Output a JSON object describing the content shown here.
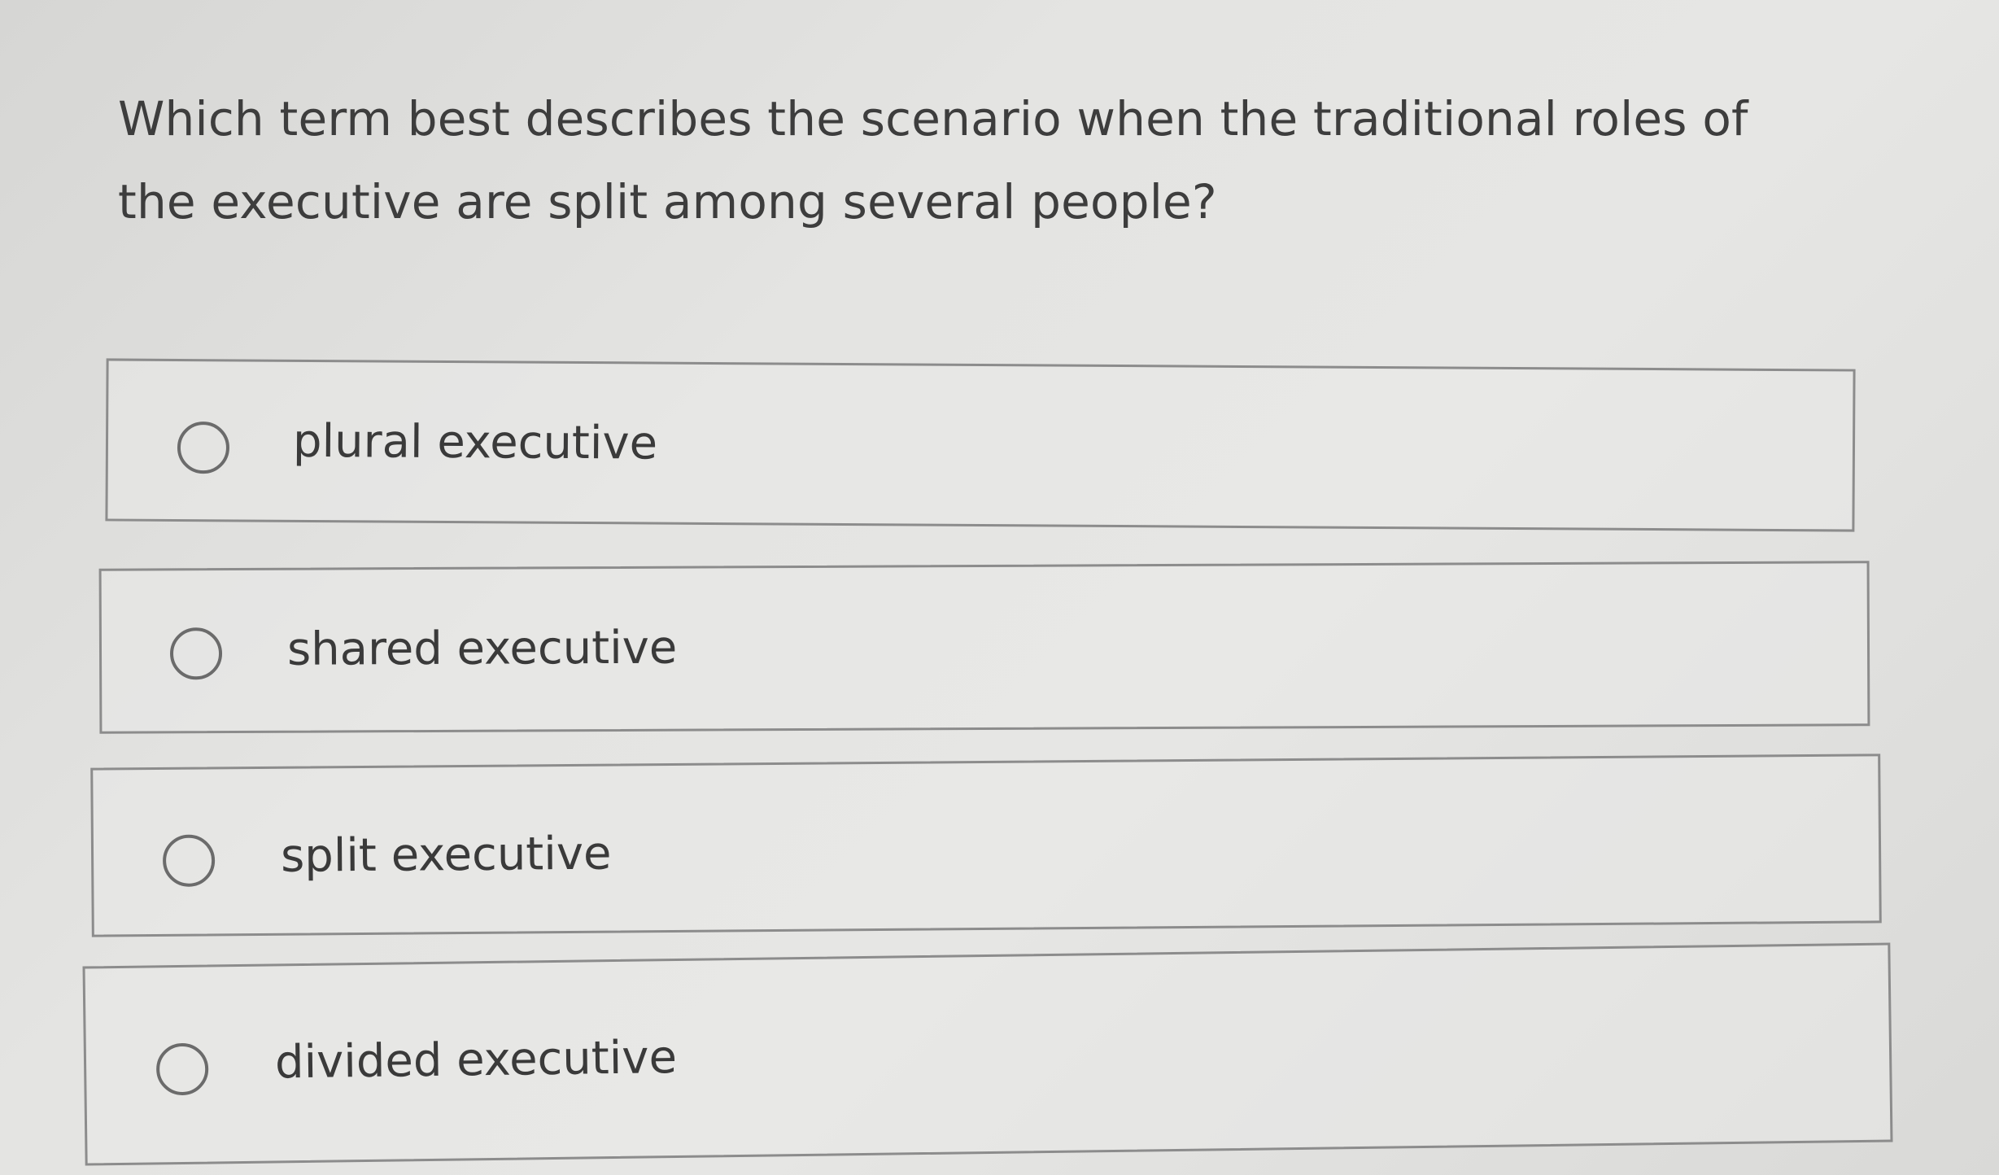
{
  "question": {
    "text": "Which term best describes the scenario when the traditional roles of the executive are split among several people?"
  },
  "options": [
    {
      "label": "plural executive",
      "selected": false
    },
    {
      "label": "shared executive",
      "selected": false
    },
    {
      "label": "split executive",
      "selected": false
    },
    {
      "label": "divided executive",
      "selected": false
    }
  ],
  "icons": {
    "radio": "radio-unselected-icon"
  }
}
